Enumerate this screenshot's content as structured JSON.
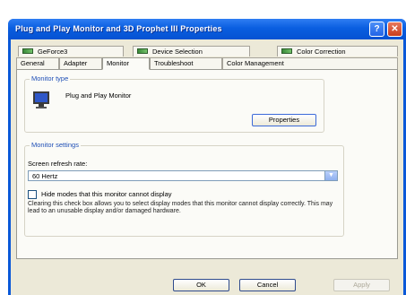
{
  "window": {
    "title": "Plug and Play Monitor and 3D Prophet III Properties",
    "help_glyph": "?",
    "close_glyph": "✕"
  },
  "tabs_row1": [
    {
      "label": "GeForce3",
      "icon": "gpu-icon"
    },
    {
      "label": "Device Selection",
      "icon": "gpu-icon"
    },
    {
      "label": "Color Correction",
      "icon": "gpu-icon"
    }
  ],
  "tabs_row2": [
    {
      "label": "General"
    },
    {
      "label": "Adapter"
    },
    {
      "label": "Monitor",
      "active": true
    },
    {
      "label": "Troubleshoot"
    },
    {
      "label": "Color Management"
    }
  ],
  "monitor_type": {
    "legend": "Monitor type",
    "name": "Plug and Play Monitor",
    "icon": "monitor-icon",
    "properties_label": "Properties"
  },
  "monitor_settings": {
    "legend": "Monitor settings",
    "refresh_label": "Screen refresh rate:",
    "refresh_value": "60 Hertz",
    "hide_modes_label": "Hide modes that this monitor cannot display",
    "hide_modes_checked": false,
    "description": "Clearing this check box allows you to select display modes that this monitor cannot display correctly. This may lead to an unusable display and/or damaged hardware."
  },
  "buttons": {
    "ok": "OK",
    "cancel": "Cancel",
    "apply": "Apply"
  },
  "colors": {
    "titlebar": "#0a5ee0",
    "dialog_bg": "#ece9d8",
    "group_legend": "#1f4fb6"
  }
}
